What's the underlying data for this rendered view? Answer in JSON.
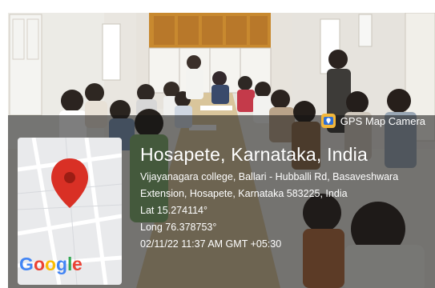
{
  "overlay": {
    "app_label": "GPS Map Camera",
    "location_title": "Hosapete, Karnataka, India",
    "address_line1": "Vijayanagara college, Ballari - Hubballi Rd, Basaveshwara",
    "address_line2": "Extension, Hosapete, Karnataka 583225, India",
    "lat": "Lat 15.274114°",
    "long": "Long 76.378753°",
    "datetime": "02/11/22 11:37 AM GMT +05:30"
  },
  "map": {
    "brand": "Google",
    "pin_color": "#d93025"
  },
  "scene": {
    "icons": [
      "gps-camera-icon",
      "map-pin-icon",
      "google-logo"
    ],
    "colors": {
      "wall": "#e9e6e0",
      "board": "#c8892f",
      "table": "#d9c59b",
      "overlay": "#141414"
    }
  }
}
